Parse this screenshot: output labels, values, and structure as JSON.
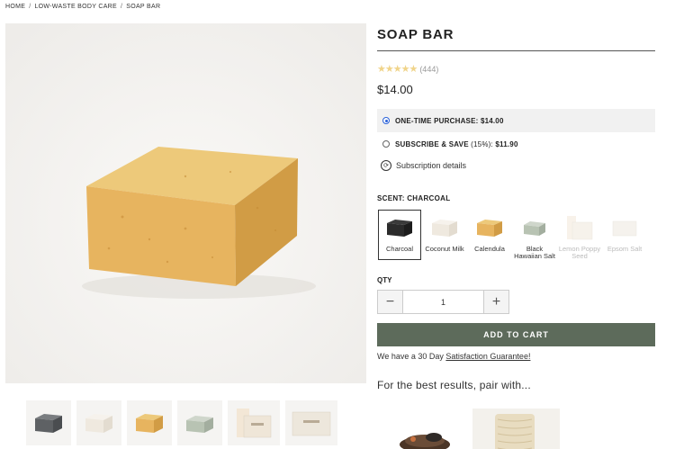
{
  "breadcrumb": {
    "home": "HOME",
    "category": "LOW-WASTE BODY CARE",
    "current": "SOAP BAR",
    "sep": "/"
  },
  "product": {
    "title": "SOAP BAR",
    "stars": "★★★★★",
    "review_count": "(444)",
    "price": "$14.00"
  },
  "purchase_options": {
    "one_time_label": "ONE-TIME PURCHASE:",
    "one_time_price": "$14.00",
    "subscribe_label": "SUBSCRIBE & SAVE",
    "subscribe_discount": "(15%):",
    "subscribe_price": "$11.90",
    "subscription_details": "Subscription details"
  },
  "scent": {
    "label": "SCENT: CHARCOAL",
    "options": [
      {
        "name": "Charcoal",
        "color": "#2b2b2b"
      },
      {
        "name": "Coconut Milk",
        "color": "#f1ece4"
      },
      {
        "name": "Calendula",
        "color": "#e0ad5a"
      },
      {
        "name": "Black Hawaiian Salt",
        "color": "#b8c3b3"
      },
      {
        "name": "Lemon Poppy Seed",
        "color": "#f3e7d6"
      },
      {
        "name": "Epsom Salt",
        "color": "#ede7dc"
      }
    ]
  },
  "quantity": {
    "label": "QTY",
    "value": "1",
    "minus": "−",
    "plus": "+"
  },
  "cart": {
    "add_label": "ADD TO CART",
    "guarantee_prefix": "We have a 30 Day ",
    "guarantee_link": "Satisfaction Guarantee!"
  },
  "pairing": {
    "title": "For the best results, pair with..."
  },
  "colors": {
    "accent": "#5d6b5b",
    "radio": "#2a62d9",
    "stars": "#f0d48a",
    "soap": "#e7b45f"
  }
}
